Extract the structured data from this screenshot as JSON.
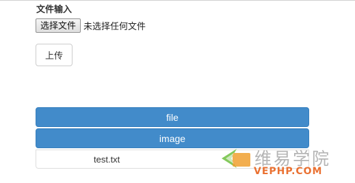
{
  "form": {
    "label": "文件输入",
    "choose_file_label": "选择文件",
    "no_file_text": "未选择任何文件",
    "upload_label": "上传"
  },
  "results": {
    "file_bar_label": "file",
    "image_bar_label": "image",
    "file_name": "test.txt"
  },
  "watermark": {
    "text_cn": "维易学院",
    "text_en": "VEPHP.COM"
  },
  "colors": {
    "primary": "#428bca",
    "watermark_orange": "#e8621c",
    "watermark_green": "#6fbf3f"
  }
}
